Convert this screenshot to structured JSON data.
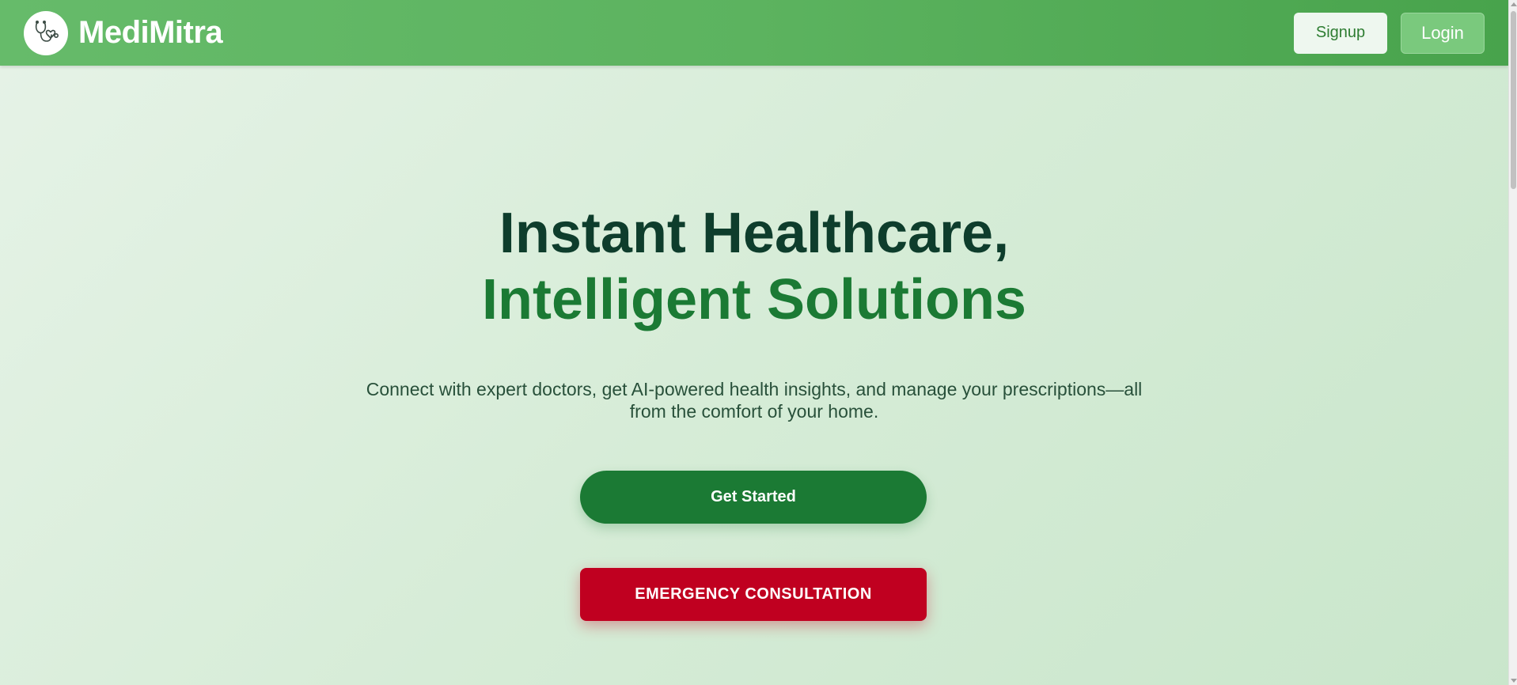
{
  "navbar": {
    "brand_name": "MediMitra",
    "logo_icon": "stethoscope-icon",
    "signup_label": "Signup",
    "login_label": "Login"
  },
  "hero": {
    "headline_line1": "Instant Healthcare,",
    "headline_line2": "Intelligent Solutions",
    "description": "Connect with expert doctors, get AI-powered health insights, and manage your prescriptions—all from the comfort of your home.",
    "get_started_label": "Get Started",
    "emergency_label": "EMERGENCY CONSULTATION"
  },
  "colors": {
    "primary_green": "#1b7a34",
    "nav_green": "#5cb35f",
    "emergency_red": "#c00020",
    "headline_dark": "#0e3d2c"
  }
}
